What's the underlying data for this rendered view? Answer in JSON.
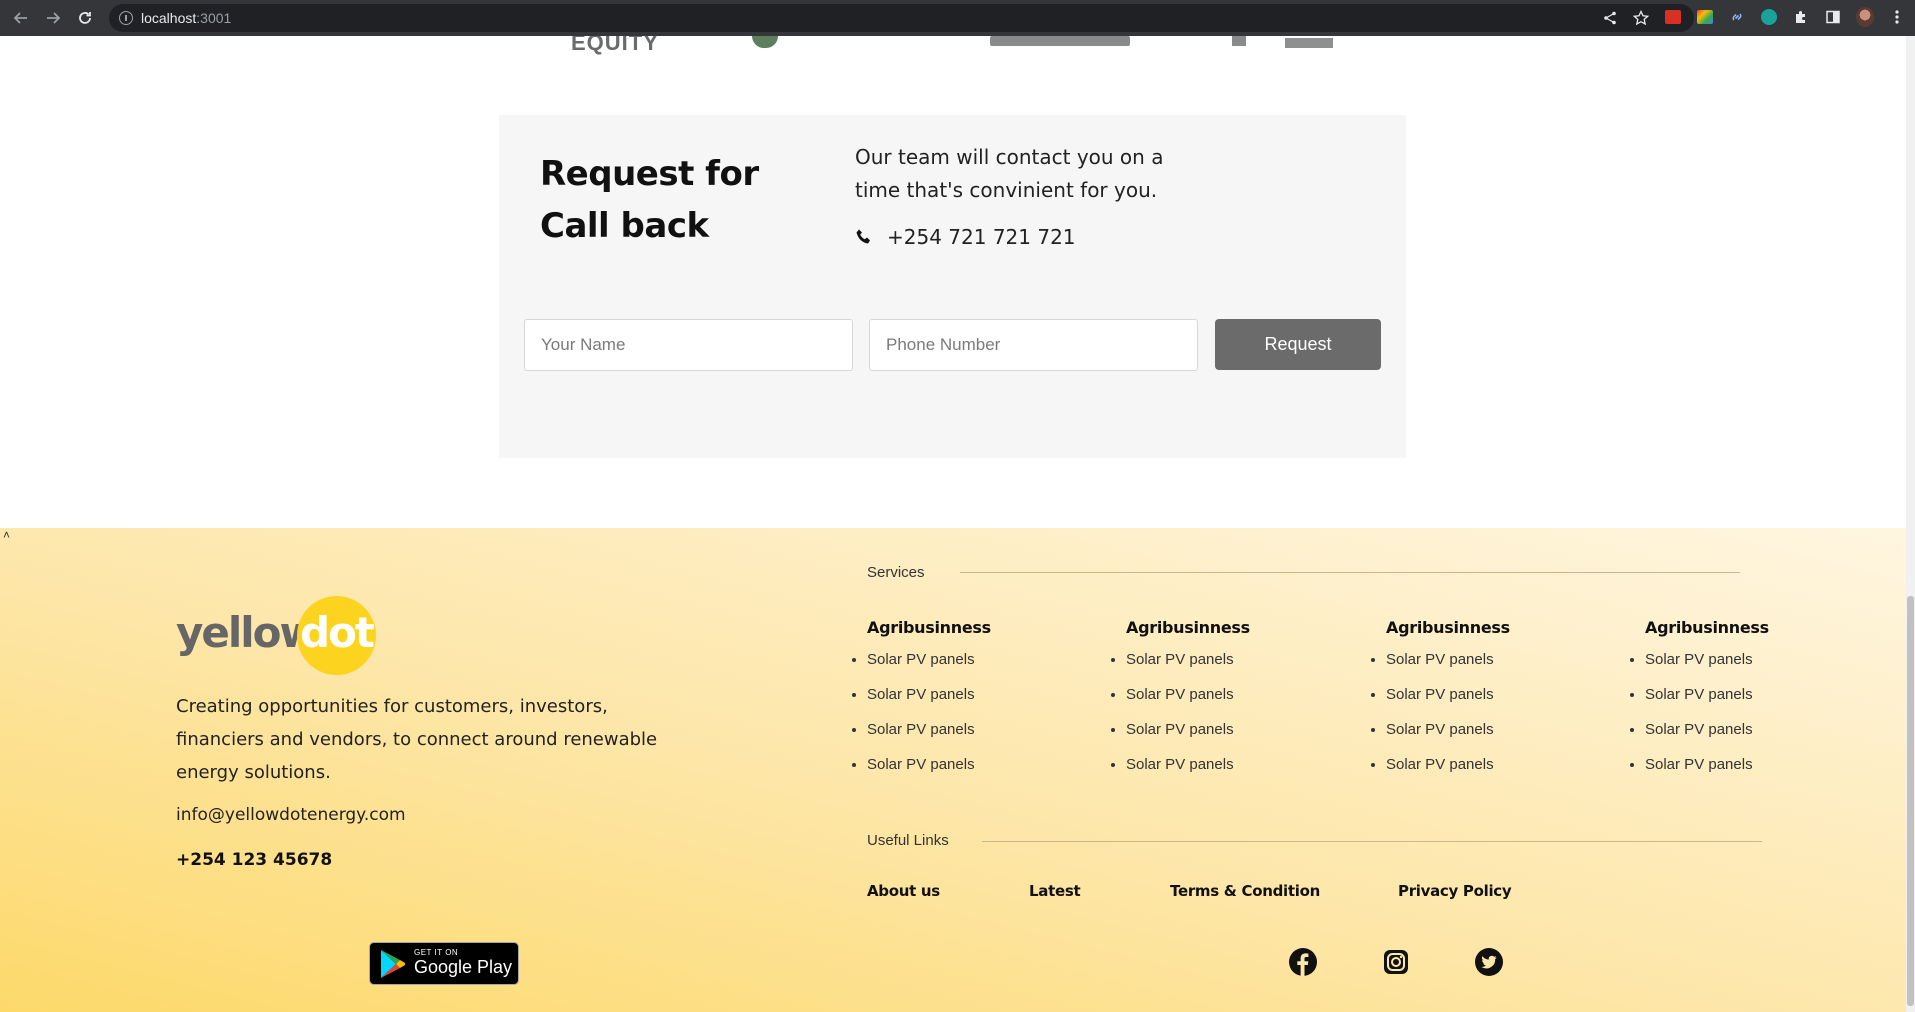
{
  "browser": {
    "url_host": "localhost",
    "url_port": ":3001"
  },
  "logos": {
    "equity": "EQUITY"
  },
  "callback": {
    "title": "Request for Call back",
    "description": "Our team will contact you on a time that's convinient for you.",
    "phone": "+254 721 721 721",
    "name_placeholder": "Your Name",
    "phone_placeholder": "Phone Number",
    "button_label": "Request"
  },
  "footer": {
    "scroll_up": "˄",
    "brand_left": "yellow",
    "brand_right": "dot",
    "about": "Creating opportunities for customers, investors, financiers and vendors, to connect around renewable energy solutions.",
    "email": "info@yellowdotenergy.com",
    "phone": "+254 123 45678",
    "google_play_small": "GET IT ON",
    "google_play_big": "Google Play",
    "services_label": "Services",
    "services": [
      {
        "heading": "Agribusinness",
        "items": [
          "Solar PV panels",
          "Solar PV panels",
          "Solar PV panels",
          "Solar PV panels"
        ]
      },
      {
        "heading": "Agribusinness",
        "items": [
          "Solar PV panels",
          "Solar PV panels",
          "Solar PV panels",
          "Solar PV panels"
        ]
      },
      {
        "heading": "Agribusinness",
        "items": [
          "Solar PV panels",
          "Solar PV panels",
          "Solar PV panels",
          "Solar PV panels"
        ]
      },
      {
        "heading": "Agribusinness",
        "items": [
          "Solar PV panels",
          "Solar PV panels",
          "Solar PV panels",
          "Solar PV panels"
        ]
      }
    ],
    "useful_links_label": "Useful Links",
    "links": [
      "About us",
      "Latest",
      "Terms & Condition",
      "Privacy Policy"
    ],
    "social": [
      "facebook-icon",
      "instagram-icon",
      "twitter-icon"
    ]
  },
  "colors": {
    "brand_yellow": "#fcd31f",
    "button_grey": "#6b6b6b",
    "card_bg": "#f6f6f6"
  }
}
